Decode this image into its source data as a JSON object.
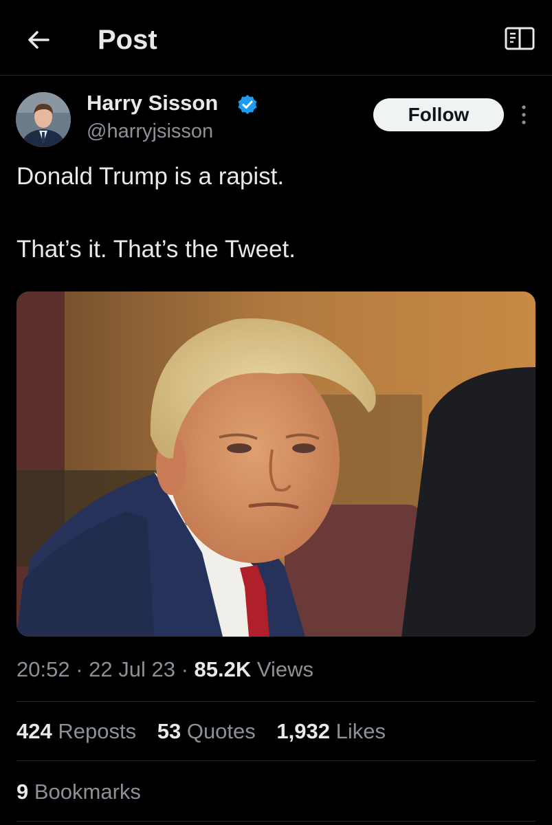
{
  "header": {
    "title": "Post",
    "back_icon": "arrow-left-icon",
    "reader_icon": "reader-mode-icon"
  },
  "author": {
    "name": "Harry Sisson",
    "handle": "@harryjsisson",
    "verified": true,
    "verified_color": "#1d9bf0",
    "follow_label": "Follow"
  },
  "post": {
    "line1": "Donald Trump is a rapist.",
    "line2": "That’s it. That’s the Tweet."
  },
  "meta": {
    "time": "20:52",
    "date": "22 Jul 23",
    "views_count": "85.2K",
    "views_label": "Views"
  },
  "stats": {
    "reposts_count": "424",
    "reposts_label": "Reposts",
    "quotes_count": "53",
    "quotes_label": "Quotes",
    "likes_count": "1,932",
    "likes_label": "Likes",
    "bookmarks_count": "9",
    "bookmarks_label": "Bookmarks"
  },
  "colors": {
    "background": "#000000",
    "text": "#e7e9ea",
    "secondary_text": "#8b9198",
    "follow_bg": "#eff3f4"
  }
}
